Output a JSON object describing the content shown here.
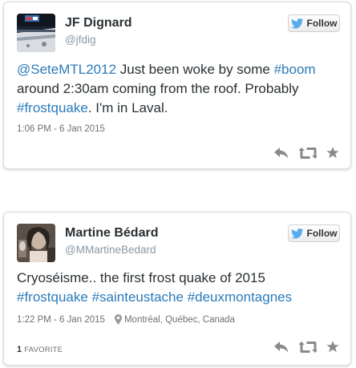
{
  "tweets": [
    {
      "author_name": "JF Dignard",
      "author_handle": "@jfdig",
      "follow_label": "Follow",
      "text_parts": {
        "mention": "@SeteMTL2012",
        "t1": " Just been woke by some ",
        "hashtag1": "#boom",
        "t2": " around 2:30am coming from the roof. Probably ",
        "hashtag2": "#frostquake",
        "t3": ". I'm in Laval."
      },
      "timestamp": "1:06 PM - 6 Jan 2015",
      "avatar_icon": "hockey-arena-avatar-icon"
    },
    {
      "author_name": "Martine Bédard",
      "author_handle": "@MMartineBedard",
      "follow_label": "Follow",
      "text_parts": {
        "t1": "Cryoséisme.. the first frost quake of 2015 ",
        "hashtag1": "#frostquake",
        "t2": " ",
        "hashtag2": "#sainteustache",
        "t3": " ",
        "hashtag3": "#deuxmontagnes"
      },
      "timestamp": "1:22 PM - 6 Jan 2015",
      "location": "Montréal, Québec, Canada",
      "favorites_count": "1",
      "favorites_label": "FAVORITE",
      "avatar_icon": "portrait-avatar-icon"
    }
  ],
  "colors": {
    "link": "#2b7bb9",
    "twitter_blue": "#55acee",
    "icon_gray": "#8a8a8a"
  }
}
